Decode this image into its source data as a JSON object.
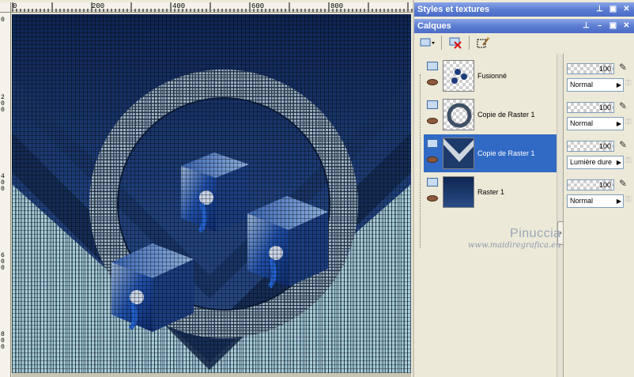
{
  "ruler_top": {
    "labels": [
      "0",
      "200",
      "400",
      "600",
      "800"
    ]
  },
  "ruler_left": {
    "labels": [
      "0",
      "2 0 0",
      "4 0 0",
      "6 0 0",
      "8 0 0"
    ]
  },
  "panels": {
    "styles_title": "Styles et textures",
    "layers_title": "Calques"
  },
  "layers": [
    {
      "name": "Fusionné",
      "opacity": "100",
      "blend": "Normal",
      "selected": false
    },
    {
      "name": "Copie de Raster 1",
      "opacity": "100",
      "blend": "Normal",
      "selected": false
    },
    {
      "name": "Copie de Raster 1",
      "opacity": "100",
      "blend": "Lumière dure",
      "selected": true
    },
    {
      "name": "Raster 1",
      "opacity": "100",
      "blend": "Normal",
      "selected": false
    }
  ],
  "watermark": {
    "name": "Pinuccia",
    "url": "www.maidiregrafica.eu"
  },
  "colors": {
    "title_bar": "#5c7dd2",
    "selection": "#316ac5",
    "panel_bg": "#ece9d8"
  },
  "icons": [
    "new-layer-icon",
    "delete-layer-icon",
    "edit-mask-icon",
    "eye-icon",
    "lock-icon",
    "pin-icon",
    "restore-icon",
    "close-icon"
  ]
}
